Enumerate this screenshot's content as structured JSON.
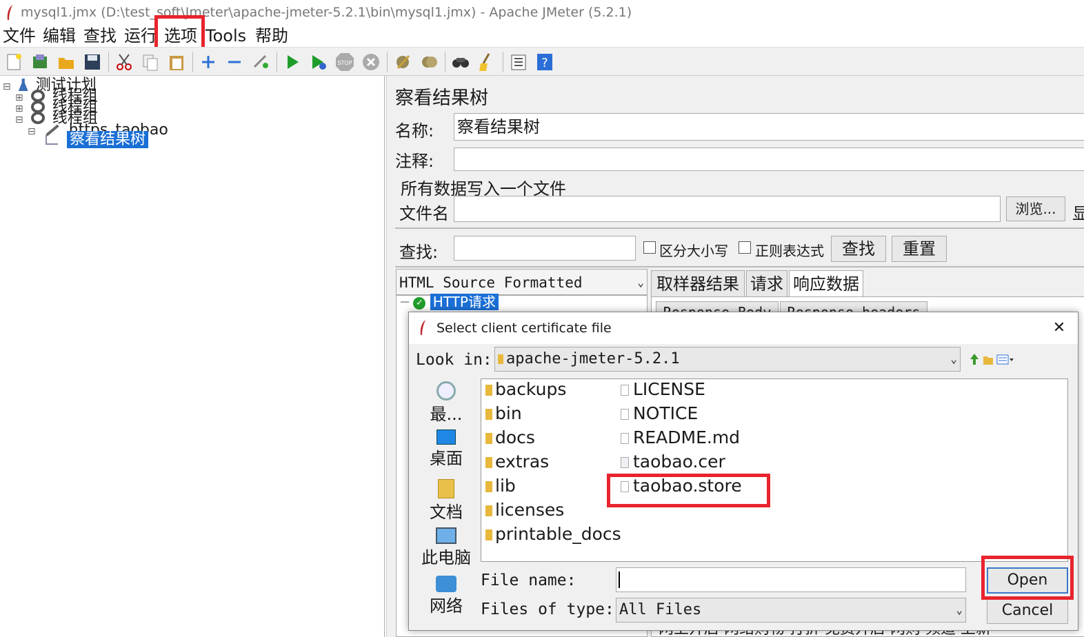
{
  "window": {
    "title": "mysql1.jmx (D:\\test_soft\\Jmeter\\apache-jmeter-5.2.1\\bin\\mysql1.jmx) - Apache JMeter (5.2.1)"
  },
  "menu": [
    "文件",
    "编辑",
    "查找",
    "运行",
    "选项",
    "Tools",
    "帮助"
  ],
  "tree": {
    "root": "测试计划",
    "groups": [
      "线程组",
      "线程组",
      "线程组"
    ],
    "sampler": "https_taobao",
    "listener": "察看结果树"
  },
  "panel": {
    "title": "察看结果树",
    "name_label": "名称:",
    "name_value": "察看结果树",
    "comment_label": "注释:",
    "comment_value": "",
    "file_section": "所有数据写入一个文件",
    "filename_label": "文件名",
    "filename_value": "",
    "browse_button": "浏览...",
    "cut_char": "显",
    "search_label": "查找:",
    "search_value": "",
    "case_checkbox": "区分大小写",
    "regex_checkbox": "正则表达式",
    "find_button": "查找",
    "reset_button": "重置",
    "renderer": "HTML Source Formatted",
    "result_node": "HTTP请求",
    "tabs": [
      "取样器结果",
      "请求",
      "响应数据"
    ],
    "subtabs": [
      "Response Body",
      "Response headers"
    ],
    "bottom_text": "网上开店 网络购物 打折 免费开店 网购 频道 上新"
  },
  "dialog": {
    "title": "Select client certificate file",
    "close": "✕",
    "lookin_label": "Look in:",
    "lookin_value": "apache-jmeter-5.2.1",
    "places": [
      "最...",
      "桌面",
      "文档",
      "此电脑",
      "网络"
    ],
    "folders": [
      "backups",
      "bin",
      "docs",
      "extras",
      "lib",
      "licenses",
      "printable_docs"
    ],
    "files": [
      "LICENSE",
      "NOTICE",
      "README.md",
      "taobao.cer",
      "taobao.store"
    ],
    "filename_label": "File name:",
    "filename_value": "",
    "filetype_label": "Files of type:",
    "filetype_value": "All Files",
    "open_button": "Open",
    "cancel_button": "Cancel"
  },
  "colors": {
    "highlight": "#e8242d",
    "selection": "#1a6fd6"
  }
}
